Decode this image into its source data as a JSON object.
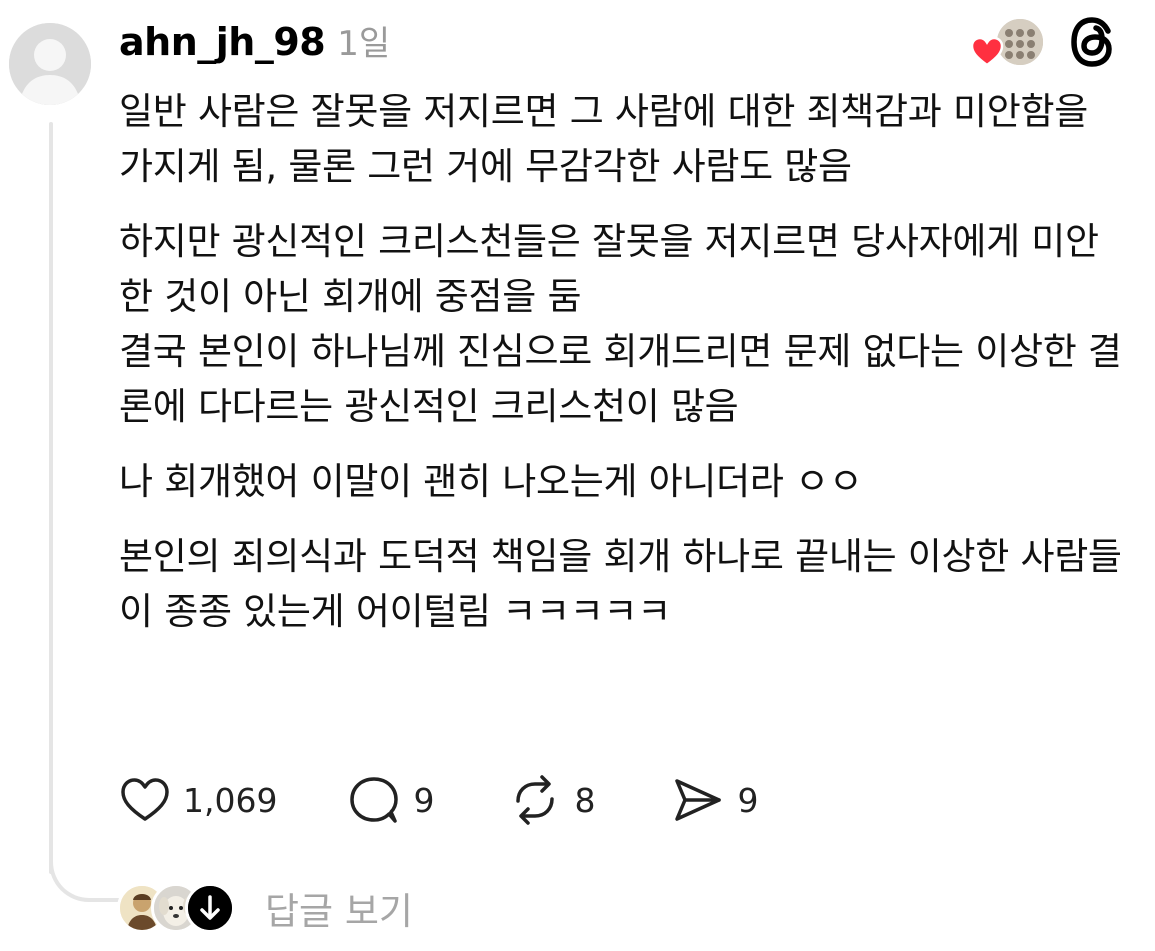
{
  "post": {
    "username": "ahn_jh_98",
    "time": "1일",
    "paragraphs": [
      "일반 사람은 잘못을 저지르면 그 사람에 대한 죄책감과 미안함을 가지게 됨, 물론 그런 거에 무감각한 사람도 많음",
      "하지만 광신적인 크리스천들은 잘못을 저지르면 당사자에게 미안한 것이 아닌 회개에 중점을 둠\n결국 본인이 하나님께 진심으로 회개드리면 문제 없다는 이상한 결론에 다다르는 광신적인 크리스천이 많음",
      "나 회개했어 이말이 괜히 나오는게 아니더라 ㅇㅇ",
      "본인의 죄의식과 도덕적 책임을 회개 하나로 끝내는 이상한 사람들이 종종 있는게 어이털림 ㅋㅋㅋㅋㅋ"
    ]
  },
  "actions": {
    "like_count": "1,069",
    "comment_count": "9",
    "repost_count": "8",
    "share_count": "9"
  },
  "replies": {
    "label": "답글 보기"
  },
  "icons": {
    "like": "heart-outline-icon",
    "comment": "speech-bubble-icon",
    "repost": "repost-arrows-icon",
    "share": "paper-plane-icon",
    "liked_badge": "heart-filled-icon",
    "threads": "threads-logo-icon",
    "expand": "arrow-down-icon"
  },
  "colors": {
    "heart_red": "#ff3040",
    "muted_text": "#a6a6a6",
    "thread_line": "#e5e5e5"
  }
}
